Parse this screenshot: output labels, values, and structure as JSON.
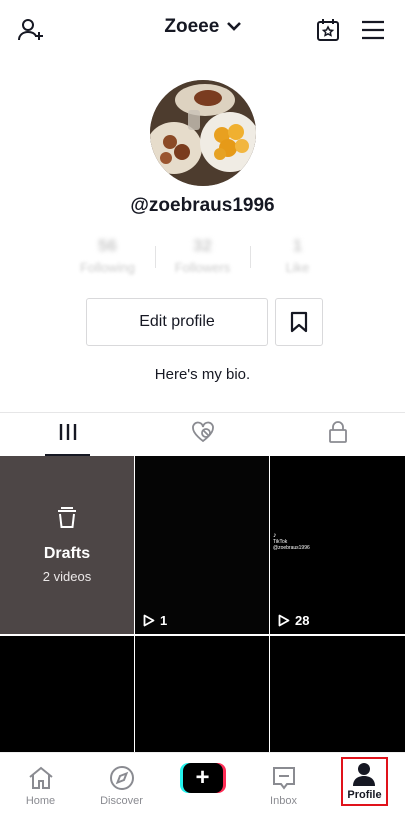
{
  "header": {
    "title": "Zoeee"
  },
  "profile": {
    "username": "@zoebraus1996",
    "bio": "Here's my bio.",
    "stats": [
      {
        "value": "56",
        "label": "Following"
      },
      {
        "value": "32",
        "label": "Followers"
      },
      {
        "value": "1",
        "label": "Like"
      }
    ],
    "edit_label": "Edit profile"
  },
  "tabs": [
    {
      "icon": "grid-icon",
      "active": true
    },
    {
      "icon": "liked-heart-icon",
      "active": false
    },
    {
      "icon": "lock-icon",
      "active": false
    }
  ],
  "grid": {
    "drafts": {
      "title": "Drafts",
      "subtitle": "2 videos"
    },
    "videos": [
      {
        "views": "1"
      },
      {
        "views": "28",
        "watermark": "TikTok",
        "watermark_user": "@zoebraus1996"
      }
    ]
  },
  "nav": {
    "home": "Home",
    "discover": "Discover",
    "inbox": "Inbox",
    "profile": "Profile"
  },
  "colors": {
    "accent_red": "#fe2c55",
    "accent_cyan": "#25f4ee",
    "highlight": "#e0121b"
  }
}
